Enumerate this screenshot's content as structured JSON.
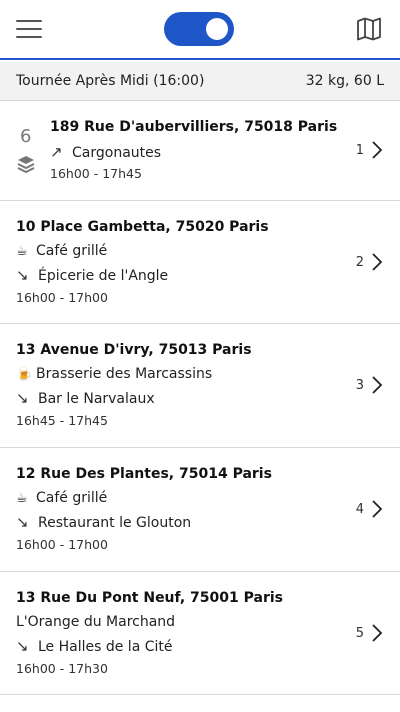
{
  "header": {
    "menu_icon": "hamburger-menu-icon",
    "toggle_state": "on",
    "map_icon": "folded-map-icon",
    "accent": "#1e56c8"
  },
  "summary": {
    "tour": "Tournée Après Midi (16:00)",
    "load": "32 kg, 60 L"
  },
  "stops": [
    {
      "count": "6",
      "address": "189 Rue D'aubervilliers, 75018 Paris",
      "pickup": "",
      "dropoff": "Cargonautes",
      "dropoff_arrow": "↗",
      "time": "16h00 - 17h45",
      "index": "1"
    },
    {
      "address": "10 Place Gambetta, 75020 Paris",
      "pickup_glyph": "☕",
      "pickup": "Café grillé",
      "dropoff_arrow": "↘",
      "dropoff": "Épicerie de l'Angle",
      "time": "16h00 - 17h00",
      "index": "2"
    },
    {
      "address": "13 Avenue D'ivry, 75013 Paris",
      "pickup_glyph": "🍺",
      "pickup": "Brasserie des Marcassins",
      "dropoff_arrow": "↘",
      "dropoff": "Bar le Narvalaux",
      "time": "16h45 - 17h45",
      "index": "3"
    },
    {
      "address": "12 Rue Des Plantes, 75014 Paris",
      "pickup_glyph": "☕",
      "pickup": "Café grillé",
      "dropoff_arrow": "↘",
      "dropoff": "Restaurant le Glouton",
      "time": "16h00 - 17h00",
      "index": "4"
    },
    {
      "address": "13 Rue Du Pont Neuf, 75001 Paris",
      "pickup_glyph": "",
      "pickup": "L'Orange du Marchand",
      "dropoff_arrow": "↘",
      "dropoff": "Le Halles de la Cité",
      "time": "16h00 - 17h30",
      "index": "5"
    }
  ]
}
